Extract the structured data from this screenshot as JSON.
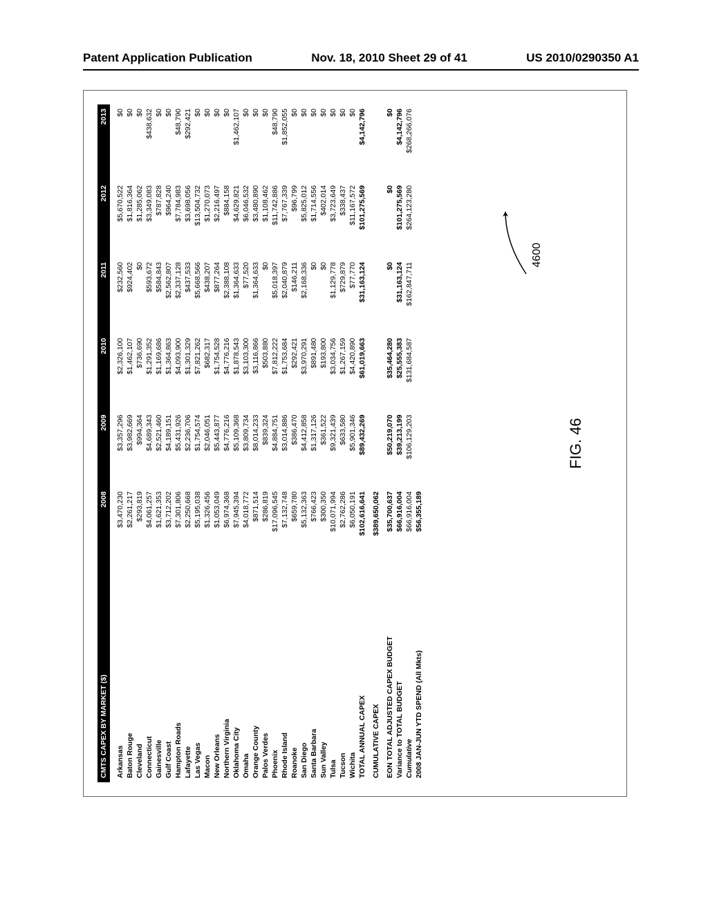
{
  "header": {
    "left": "Patent Application Publication",
    "center": "Nov. 18, 2010  Sheet 29 of 41",
    "right": "US 2010/0290350 A1"
  },
  "figure_label": "FIG. 46",
  "ref_num": "4600",
  "table": {
    "title": "CMTS CAPEX BY MARKET ($)",
    "years": [
      "2008",
      "2009",
      "2010",
      "2011",
      "2012",
      "2013"
    ],
    "rows": [
      {
        "label": "Arkansas",
        "v": [
          "$3,470,230",
          "$3,357,296",
          "$2,326,100",
          "$232,560",
          "$5,670,522",
          "$0"
        ]
      },
      {
        "label": "Baton Rouge",
        "v": [
          "$2,261,217",
          "$3,982,669",
          "$1,462,107",
          "$924,402",
          "$1,816,364",
          "$0"
        ]
      },
      {
        "label": "Cleveland",
        "v": [
          "$293,819",
          "$994,364",
          "$736,690",
          "$0",
          "$1,285,062",
          "$0"
        ]
      },
      {
        "label": "Connecticut",
        "v": [
          "$4,061,257",
          "$4,689,343",
          "$1,291,352",
          "$593,672",
          "$3,349,083",
          "$438,632"
        ]
      },
      {
        "label": "Gainesville",
        "v": [
          "$1,621,353",
          "$2,521,460",
          "$1,169,686",
          "$584,843",
          "$787,828",
          "$0"
        ]
      },
      {
        "label": "Gulf Coast",
        "v": [
          "$3,712,202",
          "$4,189,151",
          "$1,364,863",
          "$2,562,807",
          "$964,240",
          "$0"
        ]
      },
      {
        "label": "Hampton Roads",
        "v": [
          "$7,301,806",
          "$5,431,926",
          "$4,093,900",
          "$2,337,128",
          "$7,784,983",
          "$48,790"
        ]
      },
      {
        "label": "Lafayette",
        "v": [
          "$2,250,668",
          "$2,236,706",
          "$1,301,329",
          "$437,533",
          "$3,698,056",
          "$292,421"
        ]
      },
      {
        "label": "Las Vegas",
        "v": [
          "$5,195,038",
          "$1,754,574",
          "$7,821,262",
          "$5,668,566",
          "$13,504,732",
          "$0"
        ]
      },
      {
        "label": "Macon",
        "v": [
          "$1,326,456",
          "$2,046,051",
          "$682,317",
          "$438,207",
          "$1,270,073",
          "$0"
        ]
      },
      {
        "label": "New Orleans",
        "v": [
          "$1,053,049",
          "$5,443,877",
          "$1,754,528",
          "$877,264",
          "$2,216,497",
          "$0"
        ]
      },
      {
        "label": "Northern Virginia",
        "v": [
          "$6,974,368",
          "$4,776,216",
          "$4,776,216",
          "$2,388,108",
          "$884,158",
          "$0"
        ]
      },
      {
        "label": "Oklahoma City",
        "v": [
          "$7,945,394",
          "$5,109,368",
          "$1,878,543",
          "$1,364,633",
          "$4,629,821",
          "$1,462,107"
        ]
      },
      {
        "label": "Omaha",
        "v": [
          "$4,018,772",
          "$3,809,734",
          "$3,103,300",
          "$77,520",
          "$6,046,532",
          "$0"
        ]
      },
      {
        "label": "Orange County",
        "v": [
          "$871,514",
          "$8,014,233",
          "$3,116,866",
          "$1,364,633",
          "$3,480,890",
          "$0"
        ]
      },
      {
        "label": "Palos Verdes",
        "v": [
          "$286,819",
          "$839,324",
          "$503,880",
          "$0",
          "$1,108,462",
          "$0"
        ]
      },
      {
        "label": "Phoenix",
        "v": [
          "$17,096,545",
          "$4,884,751",
          "$7,812,222",
          "$5,018,397",
          "$11,742,886",
          "$48,790"
        ]
      },
      {
        "label": "Rhode Island",
        "v": [
          "$7,132,748",
          "$3,014,886",
          "$1,753,684",
          "$2,040,879",
          "$7,767,339",
          "$1,852,055"
        ]
      },
      {
        "label": "Roanoke",
        "v": [
          "$659,780",
          "$386,470",
          "$292,421",
          "$146,211",
          "$96,799",
          "$0"
        ]
      },
      {
        "label": "San Diego",
        "v": [
          "$5,132,363",
          "$4,412,858",
          "$3,970,291",
          "$2,168,336",
          "$5,825,012",
          "$0"
        ]
      },
      {
        "label": "Santa Barbara",
        "v": [
          "$766,423",
          "$1,317,126",
          "$891,480",
          "$0",
          "$1,714,556",
          "$0"
        ]
      },
      {
        "label": "Sun Valley",
        "v": [
          "$300,350",
          "$361,522",
          "$193,800",
          "$0",
          "$402,014",
          "$0"
        ]
      },
      {
        "label": "Tulsa",
        "v": [
          "$10,071,994",
          "$9,321,439",
          "$3,034,756",
          "$1,129,778",
          "$3,723,649",
          "$0"
        ]
      },
      {
        "label": "Tucson",
        "v": [
          "$2,762,286",
          "$633,580",
          "$1,267,159",
          "$729,879",
          "$338,437",
          "$0"
        ]
      },
      {
        "label": "Wichita",
        "v": [
          "$6,050,191",
          "$5,901,346",
          "$4,420,890",
          "$77,770",
          "$11,167,572",
          "$0"
        ]
      }
    ],
    "total_annual": {
      "label": "TOTAL ANNUAL CAPEX",
      "v": [
        "$102,616,641",
        "$89,432,269",
        "$61,019,663",
        "$31,163,124",
        "$101,275,569",
        "$4,142,796"
      ]
    },
    "cumulative": {
      "label": "CUMULATIVE CAPEX",
      "v": [
        "$389,650,062",
        "",
        "",
        "",
        "",
        ""
      ]
    },
    "budget": {
      "label": "EON TOTAL ADJUSTED CAPEX BUDGET",
      "v": [
        "$35,700,637",
        "$50,219,070",
        "$35,464,280",
        "$0",
        "$0",
        "$0"
      ]
    },
    "variance": {
      "label": "Variance to TOTAL BUDGET",
      "v": [
        "$66,916,004",
        "$39,213,199",
        "$25,555,383",
        "$31,163,124",
        "$101,275,569",
        "$4,142,796"
      ]
    },
    "cum2": {
      "label": "Cumulative",
      "v": [
        "$66,916,004",
        "$106,129,203",
        "$131,684,587",
        "$162,847,711",
        "$264,123,280",
        "$268,266,076"
      ]
    },
    "ytd": {
      "label": "2008 JAN-JUN YTD SPEND (All Mkts)",
      "v": [
        "$56,355,189",
        "",
        "",
        "",
        "",
        ""
      ]
    }
  }
}
